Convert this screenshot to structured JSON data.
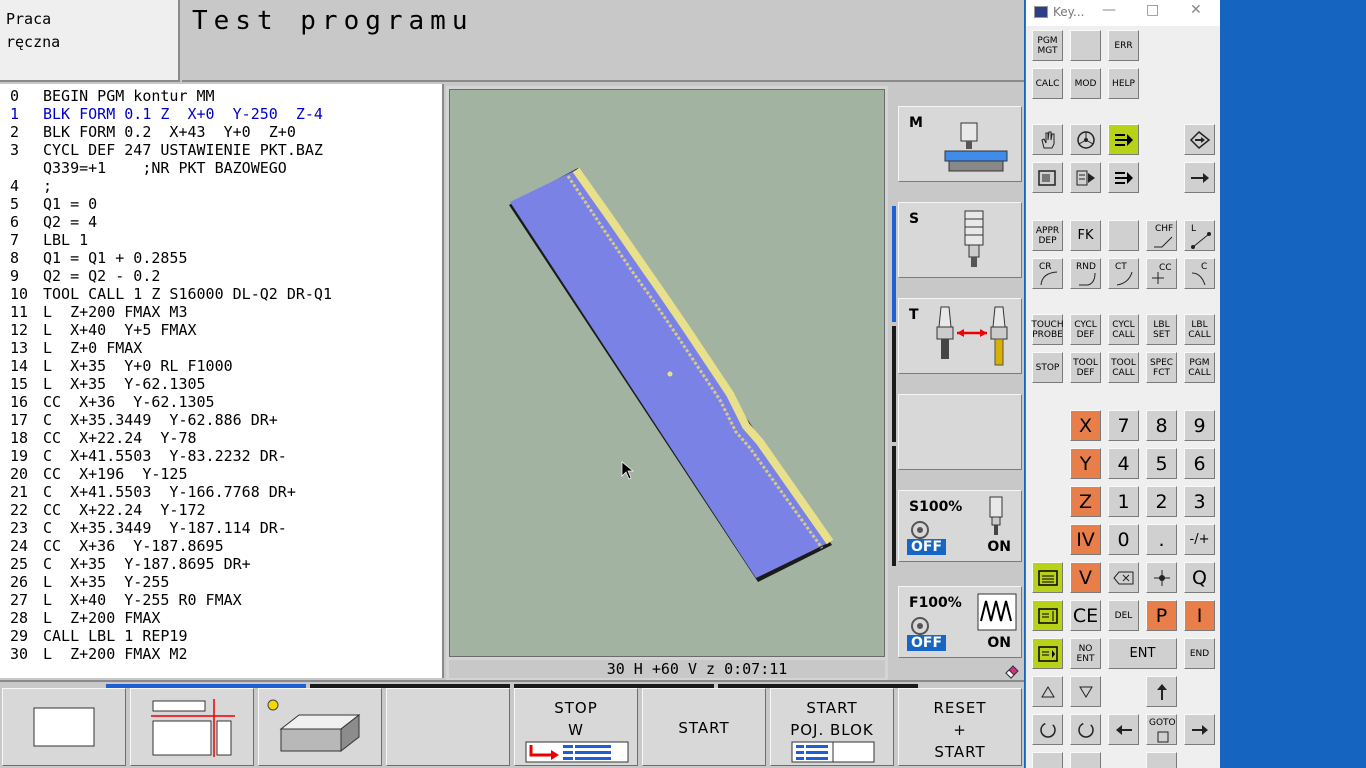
{
  "header": {
    "mode_line1": "Praca",
    "mode_line2": "ręczna",
    "title": "Test programu"
  },
  "program_lines": [
    {
      "n": "0",
      "t": "BEGIN PGM kontur MM",
      "active": false
    },
    {
      "n": "1",
      "t": "BLK FORM 0.1 Z  X+0  Y-250  Z-4",
      "active": true
    },
    {
      "n": "2",
      "t": "BLK FORM 0.2  X+43  Y+0  Z+0",
      "active": false
    },
    {
      "n": "3",
      "t": "CYCL DEF 247 USTAWIENIE PKT.BAZ",
      "active": false
    },
    {
      "n": "",
      "t": "Q339=+1    ;NR PKT BAZOWEGO",
      "active": false
    },
    {
      "n": "4",
      "t": ";",
      "active": false
    },
    {
      "n": "5",
      "t": "Q1 = 0",
      "active": false
    },
    {
      "n": "6",
      "t": "Q2 = 4",
      "active": false
    },
    {
      "n": "7",
      "t": "LBL 1",
      "active": false
    },
    {
      "n": "8",
      "t": "Q1 = Q1 + 0.2855",
      "active": false
    },
    {
      "n": "9",
      "t": "Q2 = Q2 - 0.2",
      "active": false
    },
    {
      "n": "10",
      "t": "TOOL CALL 1 Z S16000 DL-Q2 DR-Q1",
      "active": false
    },
    {
      "n": "11",
      "t": "L  Z+200 FMAX M3",
      "active": false
    },
    {
      "n": "12",
      "t": "L  X+40  Y+5 FMAX",
      "active": false
    },
    {
      "n": "13",
      "t": "L  Z+0 FMAX",
      "active": false
    },
    {
      "n": "14",
      "t": "L  X+35  Y+0 RL F1000",
      "active": false
    },
    {
      "n": "15",
      "t": "L  X+35  Y-62.1305",
      "active": false
    },
    {
      "n": "16",
      "t": "CC  X+36  Y-62.1305",
      "active": false
    },
    {
      "n": "17",
      "t": "C  X+35.3449  Y-62.886 DR+",
      "active": false
    },
    {
      "n": "18",
      "t": "CC  X+22.24  Y-78",
      "active": false
    },
    {
      "n": "19",
      "t": "C  X+41.5503  Y-83.2232 DR-",
      "active": false
    },
    {
      "n": "20",
      "t": "CC  X+196  Y-125",
      "active": false
    },
    {
      "n": "21",
      "t": "C  X+41.5503  Y-166.7768 DR+",
      "active": false
    },
    {
      "n": "22",
      "t": "CC  X+22.24  Y-172",
      "active": false
    },
    {
      "n": "23",
      "t": "C  X+35.3449  Y-187.114 DR-",
      "active": false
    },
    {
      "n": "24",
      "t": "CC  X+36  Y-187.8695",
      "active": false
    },
    {
      "n": "25",
      "t": "C  X+35  Y-187.8695 DR+",
      "active": false
    },
    {
      "n": "26",
      "t": "L  X+35  Y-255",
      "active": false
    },
    {
      "n": "27",
      "t": "L  X+40  Y-255 R0 FMAX",
      "active": false
    },
    {
      "n": "28",
      "t": "L  Z+200 FMAX",
      "active": false
    },
    {
      "n": "29",
      "t": "CALL LBL 1 REP19",
      "active": false
    },
    {
      "n": "30",
      "t": "L  Z+200 FMAX M2",
      "active": false
    }
  ],
  "graphic_status": "30 H +60 V z     0:07:11",
  "right_panel": {
    "m_label": "M",
    "s_label": "S",
    "t_label": "T",
    "spindle_override": "S100%",
    "feed_override": "F100%",
    "off_label": "OFF",
    "on_label": "ON"
  },
  "softkeys": {
    "stop_w": [
      "STOP",
      "W"
    ],
    "start": "START",
    "start_poj": [
      "START",
      "POJ. BLOK"
    ],
    "reset_start": [
      "RESET",
      "+",
      "START"
    ]
  },
  "keyboard": {
    "title": "Key...",
    "keys": {
      "pgm_mgt": "PGM\nMGT",
      "err": "ERR",
      "calc": "CALC",
      "mod": "MOD",
      "help": "HELP",
      "appr_dep": "APPR\nDEP",
      "fk": "FK",
      "chf": "CHF",
      "l": "L",
      "cr": "CR",
      "rnd": "RND",
      "ct": "CT",
      "cc": "CC",
      "c": "C",
      "touch_probe": "TOUCH\nPROBE",
      "cycl_def": "CYCL\nDEF",
      "cycl_call": "CYCL\nCALL",
      "lbl_set": "LBL\nSET",
      "lbl_call": "LBL\nCALL",
      "stop": "STOP",
      "tool_def": "TOOL\nDEF",
      "tool_call": "TOOL\nCALL",
      "spec_fct": "SPEC\nFCT",
      "pgm_call": "PGM\nCALL",
      "x": "X",
      "y": "Y",
      "z": "Z",
      "iv": "IV",
      "v": "V",
      "n7": "7",
      "n8": "8",
      "n9": "9",
      "n4": "4",
      "n5": "5",
      "n6": "6",
      "n1": "1",
      "n2": "2",
      "n3": "3",
      "n0": "0",
      "dot": ".",
      "sign": "-/+",
      "q": "Q",
      "ce": "CE",
      "del": "DEL",
      "p": "P",
      "i": "I",
      "no_ent": "NO\nENT",
      "ent": "ENT",
      "end": "END",
      "goto": "GOTO"
    }
  },
  "colors": {
    "program_active": "#0000c8",
    "sim_workpiece": "#7b82e6",
    "sim_background": "#a3b3a2",
    "sim_edge": "#e8e08a",
    "orange_key": "#e87e4a",
    "green_key": "#b8d21a",
    "off_badge": "#1866c4",
    "desktop": "#1565c0"
  }
}
